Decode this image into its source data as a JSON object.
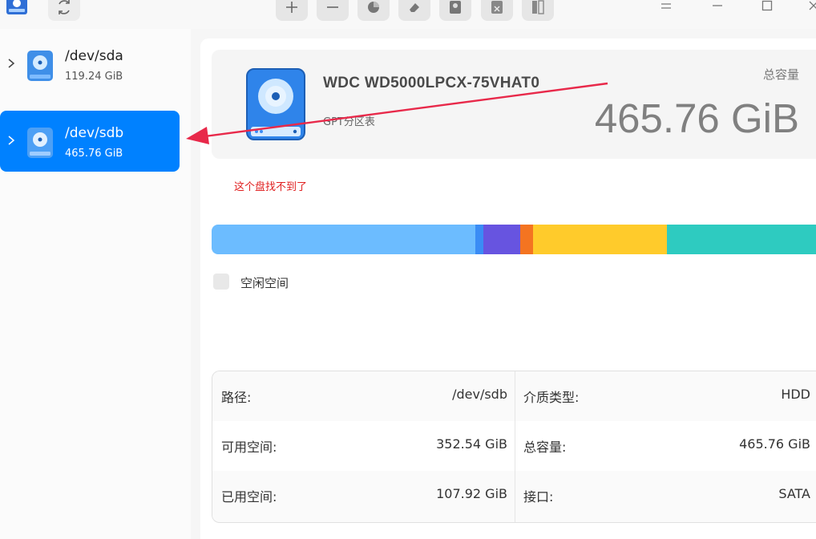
{
  "toolbar": {
    "icons": [
      "app-logo",
      "refresh-icon",
      "plus-icon",
      "minus-icon",
      "pie-chart-icon",
      "eraser-icon",
      "disk-check-icon",
      "delete-icon",
      "split-icon"
    ]
  },
  "window": {
    "icons": [
      "menu-icon",
      "minimize-icon",
      "maximize-icon",
      "close-icon"
    ]
  },
  "sidebar": {
    "items": [
      {
        "name": "/dev/sda",
        "size": "119.24 GiB",
        "selected": false
      },
      {
        "name": "/dev/sdb",
        "size": "465.76 GiB",
        "selected": true
      }
    ]
  },
  "disk": {
    "model": "WDC WD5000LPCX-75VHAT0",
    "partition_table": "GPT分区表",
    "capacity_label": "总容量",
    "capacity_value": "465.76 GiB"
  },
  "annotation": {
    "text": "这个盘找不到了",
    "color": "#e02020"
  },
  "usage_bar": {
    "segments": [
      {
        "fraction": 0.436,
        "color": "#6cbcff"
      },
      {
        "fraction": 0.013,
        "color": "#3a8cf5"
      },
      {
        "fraction": 0.062,
        "color": "#6754e0"
      },
      {
        "fraction": 0.021,
        "color": "#f47421"
      },
      {
        "fraction": 0.221,
        "color": "#ffcb2b"
      },
      {
        "fraction": 0.247,
        "color": "#2ecbc0"
      }
    ]
  },
  "legend": {
    "free_label": "空闲空间"
  },
  "info": {
    "path_label": "路径:",
    "path_value": "/dev/sdb",
    "media_label": "介质类型:",
    "media_value": "HDD",
    "available_label": "可用空间:",
    "available_value": "352.54 GiB",
    "total_label": "总容量:",
    "total_value": "465.76 GiB",
    "used_label": "已用空间:",
    "used_value": "107.92 GiB",
    "interface_label": "接口:",
    "interface_value": "SATA"
  },
  "colors": {
    "accent": "#0081ff",
    "arrow": "#e8294a"
  }
}
